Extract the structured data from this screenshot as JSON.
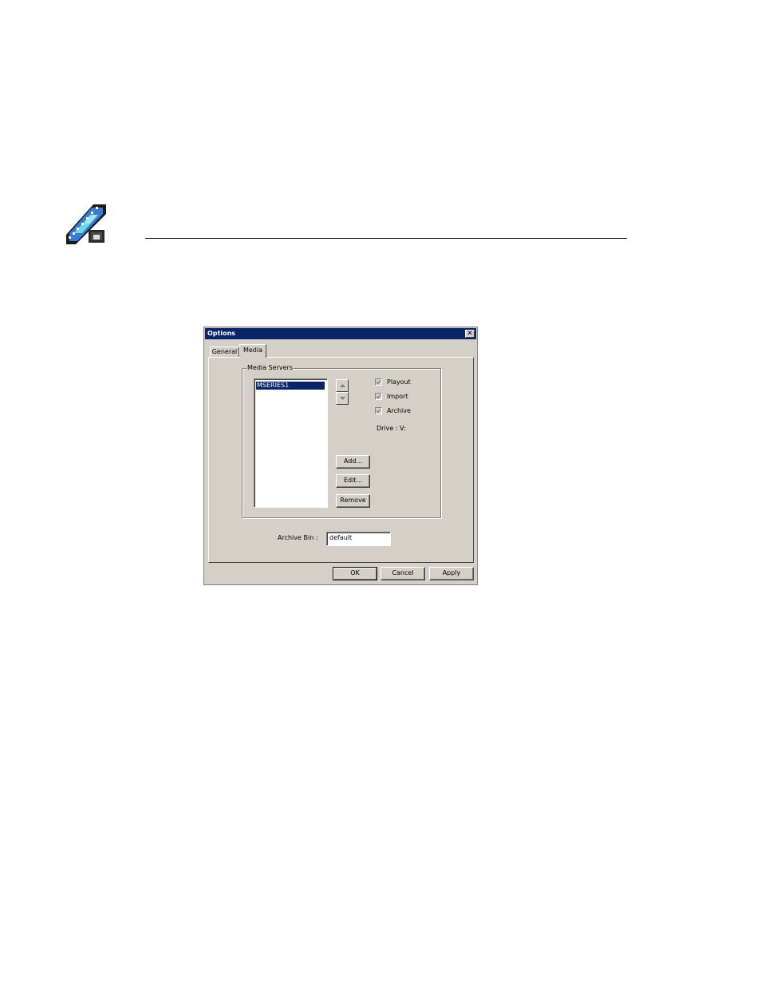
{
  "document": {
    "icon": "film-strip-icon"
  },
  "dialog": {
    "title": "Options",
    "close_glyph": "✕",
    "tabs": [
      {
        "label": "General",
        "selected": false
      },
      {
        "label": "Media",
        "selected": true
      }
    ],
    "media_servers": {
      "group_label": "Media Servers",
      "items": [
        "MSERIES1"
      ],
      "selected_index": 0,
      "checkboxes": [
        {
          "label": "Playout",
          "checked": true,
          "enabled": false
        },
        {
          "label": "Import",
          "checked": true,
          "enabled": false
        },
        {
          "label": "Archive",
          "checked": true,
          "enabled": false
        }
      ],
      "drive_label": "Drive :",
      "drive_value": "V:",
      "buttons": {
        "add": "Add...",
        "edit": "Edit...",
        "remove": "Remove"
      }
    },
    "archive_bin": {
      "label": "Archive Bin :",
      "value": "default"
    },
    "footer": {
      "ok": "OK",
      "cancel": "Cancel",
      "apply": "Apply"
    },
    "colors": {
      "face": "#d4d0c8",
      "titlebar": "#0a246a",
      "selection": "#0a246a"
    }
  }
}
